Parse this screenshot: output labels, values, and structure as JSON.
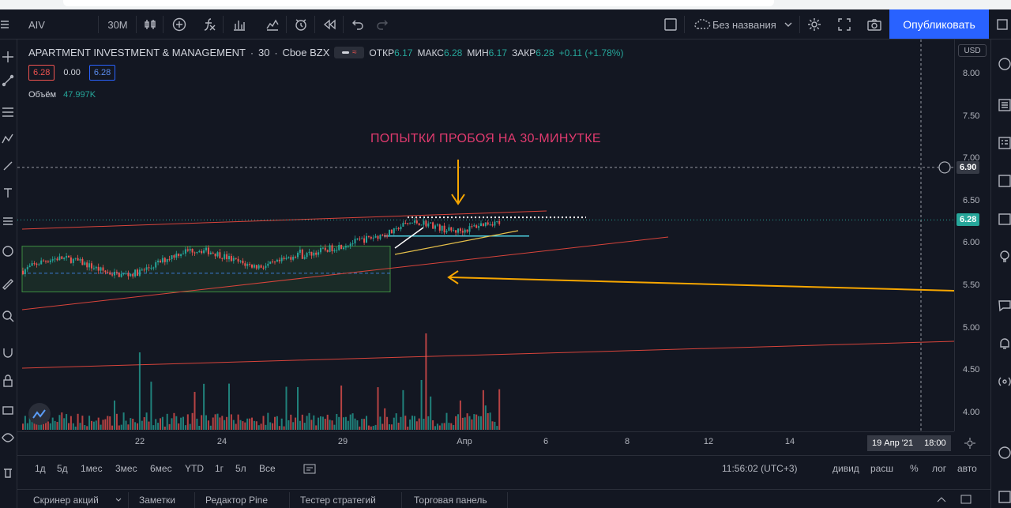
{
  "toolbar": {
    "symbol": "AIV",
    "interval": "30М",
    "layout_name": "Без названия",
    "publish_label": "Опубликовать"
  },
  "legend": {
    "title": "APARTMENT INVESTMENT & MANAGEMENT",
    "interval": "30",
    "exchange": "Cboe BZX",
    "open_key": "ОТКР",
    "open": "6.17",
    "high_key": "МАКС",
    "high": "6.28",
    "low_key": "МИН",
    "low": "6.17",
    "close_key": "ЗАКР",
    "close": "6.28",
    "change": "+0.11 (+1.78%)",
    "sell_price": "6.28",
    "spread": "0.00",
    "buy_price": "6.28",
    "volume_label": "Объём",
    "volume": "47.997K"
  },
  "annotation": "ПОПЫТКИ ПРОБОЯ НА 30-МИНУТКЕ",
  "price_axis": {
    "currency": "USD",
    "ticks": [
      "8.00",
      "7.50",
      "7.00",
      "6.50",
      "6.00",
      "5.50",
      "5.00",
      "4.50",
      "4.00"
    ],
    "crosshair_price": "6.90",
    "last_price": "6.28"
  },
  "time_axis": {
    "ticks": [
      "22",
      "24",
      "29",
      "Апр",
      "6",
      "8",
      "12",
      "14"
    ],
    "crosshair_date": "19 Апр '21",
    "crosshair_time": "18:00"
  },
  "ranges": {
    "items": [
      "1д",
      "5д",
      "1мес",
      "3мес",
      "6мес",
      "YTD",
      "1г",
      "5л",
      "Все"
    ],
    "clock": "11:56:02 (UTC+3)",
    "dividends": "дивид",
    "extended": "расш",
    "percent": "%",
    "log": "лог",
    "auto": "авто"
  },
  "bottom_tabs": [
    "Скринер акций",
    "Заметки",
    "Редактор Pine",
    "Тестер стратегий",
    "Торговая панель"
  ],
  "colors": {
    "background": "#131722",
    "up": "#26a69a",
    "down": "#ef5350",
    "accent": "#2962ff",
    "annotation": "#e03a6e",
    "trendline": "#f7a600"
  },
  "chart_data": {
    "type": "candlestick",
    "ylim": [
      3.8,
      8.2
    ],
    "x_labels": [
      "22",
      "24",
      "29",
      "Апр",
      "6",
      "8",
      "12",
      "14"
    ],
    "last_close": 6.28,
    "crosshair_price": 6.9,
    "range_box": {
      "low": 5.43,
      "high": 5.97
    },
    "resistance_level": 6.31,
    "support_level": 6.09
  }
}
